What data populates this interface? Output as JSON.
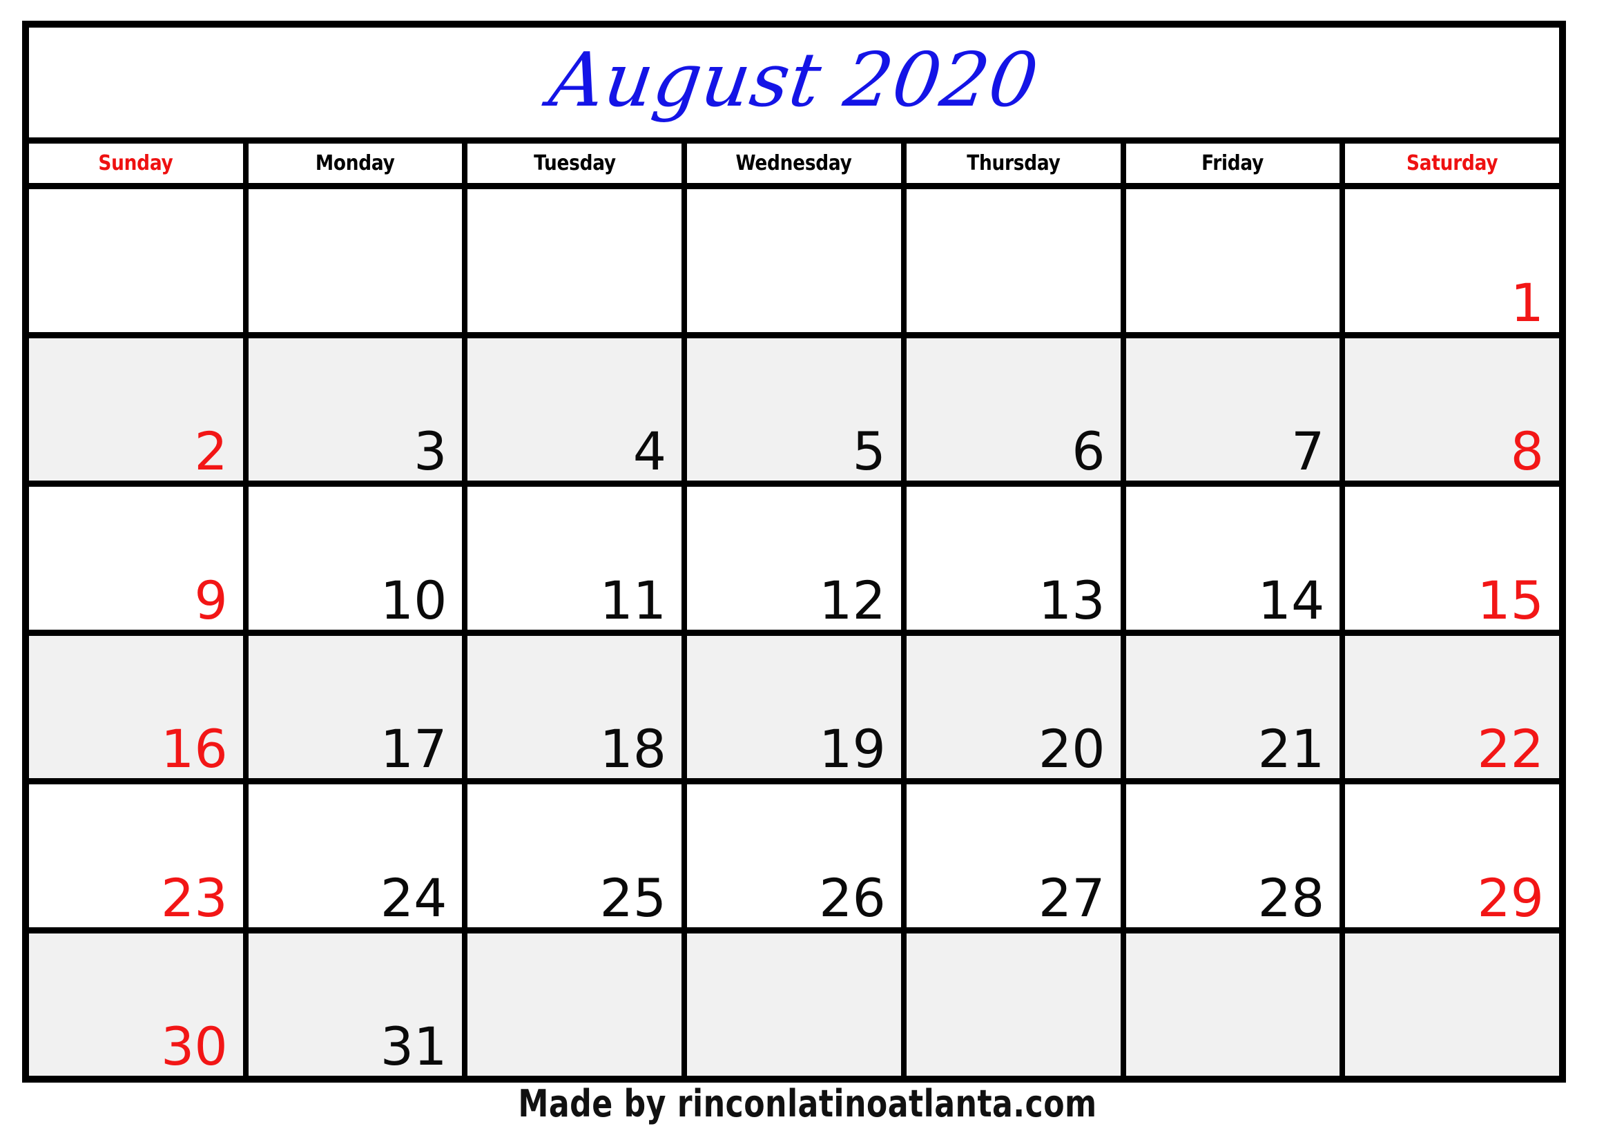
{
  "calendar": {
    "title": "August 2020",
    "month": "August",
    "year": "2020",
    "colors": {
      "title_blue": "#1414e6",
      "weekend_red": "#ee1111",
      "weekday_black": "#000000",
      "shaded_row": "#f1f1f1",
      "border": "#000000",
      "cell_background": "#ffffff"
    },
    "weekdays": [
      {
        "label": "Sunday",
        "weekend": true
      },
      {
        "label": "Monday",
        "weekend": false
      },
      {
        "label": "Tuesday",
        "weekend": false
      },
      {
        "label": "Wednesday",
        "weekend": false
      },
      {
        "label": "Thursday",
        "weekend": false
      },
      {
        "label": "Friday",
        "weekend": false
      },
      {
        "label": "Saturday",
        "weekend": true
      }
    ],
    "weeks": [
      {
        "shaded": false,
        "days": [
          {
            "number": ""
          },
          {
            "number": ""
          },
          {
            "number": ""
          },
          {
            "number": ""
          },
          {
            "number": ""
          },
          {
            "number": ""
          },
          {
            "number": "1"
          }
        ]
      },
      {
        "shaded": true,
        "days": [
          {
            "number": "2"
          },
          {
            "number": "3"
          },
          {
            "number": "4"
          },
          {
            "number": "5"
          },
          {
            "number": "6"
          },
          {
            "number": "7"
          },
          {
            "number": "8"
          }
        ]
      },
      {
        "shaded": false,
        "days": [
          {
            "number": "9"
          },
          {
            "number": "10"
          },
          {
            "number": "11"
          },
          {
            "number": "12"
          },
          {
            "number": "13"
          },
          {
            "number": "14"
          },
          {
            "number": "15"
          }
        ]
      },
      {
        "shaded": true,
        "days": [
          {
            "number": "16"
          },
          {
            "number": "17"
          },
          {
            "number": "18"
          },
          {
            "number": "19"
          },
          {
            "number": "20"
          },
          {
            "number": "21"
          },
          {
            "number": "22"
          }
        ]
      },
      {
        "shaded": false,
        "days": [
          {
            "number": "23"
          },
          {
            "number": "24"
          },
          {
            "number": "25"
          },
          {
            "number": "26"
          },
          {
            "number": "27"
          },
          {
            "number": "28"
          },
          {
            "number": "29"
          }
        ]
      },
      {
        "shaded": true,
        "days": [
          {
            "number": "30"
          },
          {
            "number": "31"
          },
          {
            "number": ""
          },
          {
            "number": ""
          },
          {
            "number": ""
          },
          {
            "number": ""
          },
          {
            "number": ""
          }
        ]
      }
    ],
    "credit": "Made by rinconlatinoatlanta.com"
  }
}
